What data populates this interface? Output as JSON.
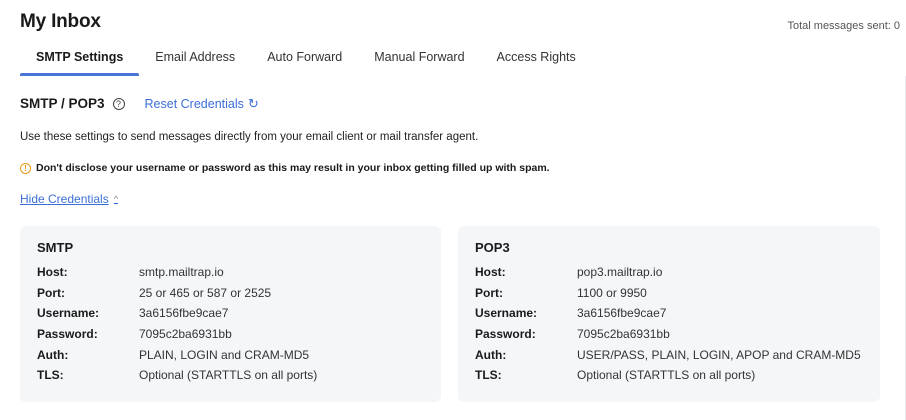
{
  "header": {
    "title": "My Inbox",
    "total_sent": "Total messages sent: 0"
  },
  "tabs": [
    {
      "label": "SMTP Settings",
      "active": true
    },
    {
      "label": "Email Address",
      "active": false
    },
    {
      "label": "Auto Forward",
      "active": false
    },
    {
      "label": "Manual Forward",
      "active": false
    },
    {
      "label": "Access Rights",
      "active": false
    }
  ],
  "section": {
    "title": "SMTP / POP3",
    "help_glyph": "?",
    "reset_label": "Reset Credentials",
    "reset_glyph": "↻",
    "description": "Use these settings to send messages directly from your email client or mail transfer agent.",
    "warning_glyph": "!",
    "warning": "Don't disclose your username or password as this may result in your inbox getting filled up with spam.",
    "hide_label": "Hide Credentials",
    "hide_glyph": "^"
  },
  "smtp": {
    "title": "SMTP",
    "rows": [
      {
        "key": "Host:",
        "value": "smtp.mailtrap.io"
      },
      {
        "key": "Port:",
        "value": "25 or 465 or 587 or 2525"
      },
      {
        "key": "Username:",
        "value": "3a6156fbe9cae7"
      },
      {
        "key": "Password:",
        "value": "7095c2ba6931bb"
      },
      {
        "key": "Auth:",
        "value": "PLAIN, LOGIN and CRAM-MD5"
      },
      {
        "key": "TLS:",
        "value": "Optional (STARTTLS on all ports)"
      }
    ]
  },
  "pop3": {
    "title": "POP3",
    "rows": [
      {
        "key": "Host:",
        "value": "pop3.mailtrap.io"
      },
      {
        "key": "Port:",
        "value": "1100 or 9950"
      },
      {
        "key": "Username:",
        "value": "3a6156fbe9cae7"
      },
      {
        "key": "Password:",
        "value": "7095c2ba6931bb"
      },
      {
        "key": "Auth:",
        "value": "USER/PASS, PLAIN, LOGIN, APOP and CRAM-MD5"
      },
      {
        "key": "TLS:",
        "value": "Optional (STARTTLS on all ports)"
      }
    ]
  },
  "colors": {
    "accent": "#4a73d8",
    "link": "#3b6fd8",
    "warning": "#e89b17",
    "card_bg": "#f4f6f8"
  },
  "icons": {
    "help": "help-circle-icon",
    "reset": "refresh-icon",
    "warning": "warning-circle-icon",
    "hide": "chevron-up-icon"
  }
}
